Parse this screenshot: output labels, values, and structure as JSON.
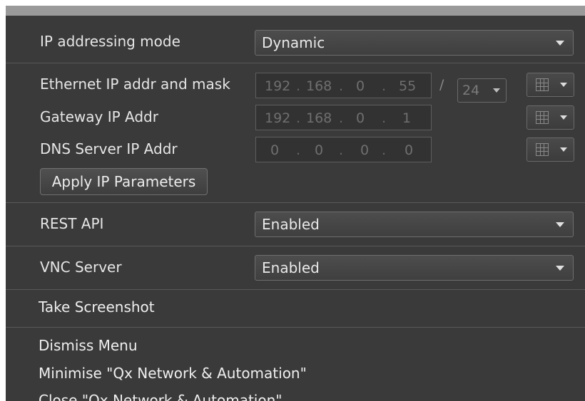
{
  "ip_mode": {
    "label": "IP addressing mode",
    "value": "Dynamic"
  },
  "ethernet": {
    "label": "Ethernet IP addr and mask",
    "octets": [
      "192",
      "168",
      "0",
      "55"
    ],
    "slash": "/",
    "mask": "24"
  },
  "gateway": {
    "label": "Gateway IP Addr",
    "octets": [
      "192",
      "168",
      "0",
      "1"
    ]
  },
  "dns": {
    "label": "DNS Server IP Addr",
    "octets": [
      "0",
      "0",
      "0",
      "0"
    ]
  },
  "separator": ".",
  "apply_button": "Apply IP Parameters",
  "rest_api": {
    "label": "REST API",
    "value": "Enabled"
  },
  "vnc": {
    "label": "VNC Server",
    "value": "Enabled"
  },
  "menu": {
    "screenshot": "Take Screenshot",
    "dismiss": "Dismiss Menu",
    "minimise": "Minimise \"Qx Network & Automation\"",
    "close": "Close \"Qx Network & Automation\""
  },
  "icons": {
    "dropdown": "chevron-down-icon",
    "keypad": "keypad-grid-icon"
  },
  "colors": {
    "panel": "#3a3a3a",
    "text": "#e6e6e6",
    "disabled_text": "#6f6f6f"
  }
}
